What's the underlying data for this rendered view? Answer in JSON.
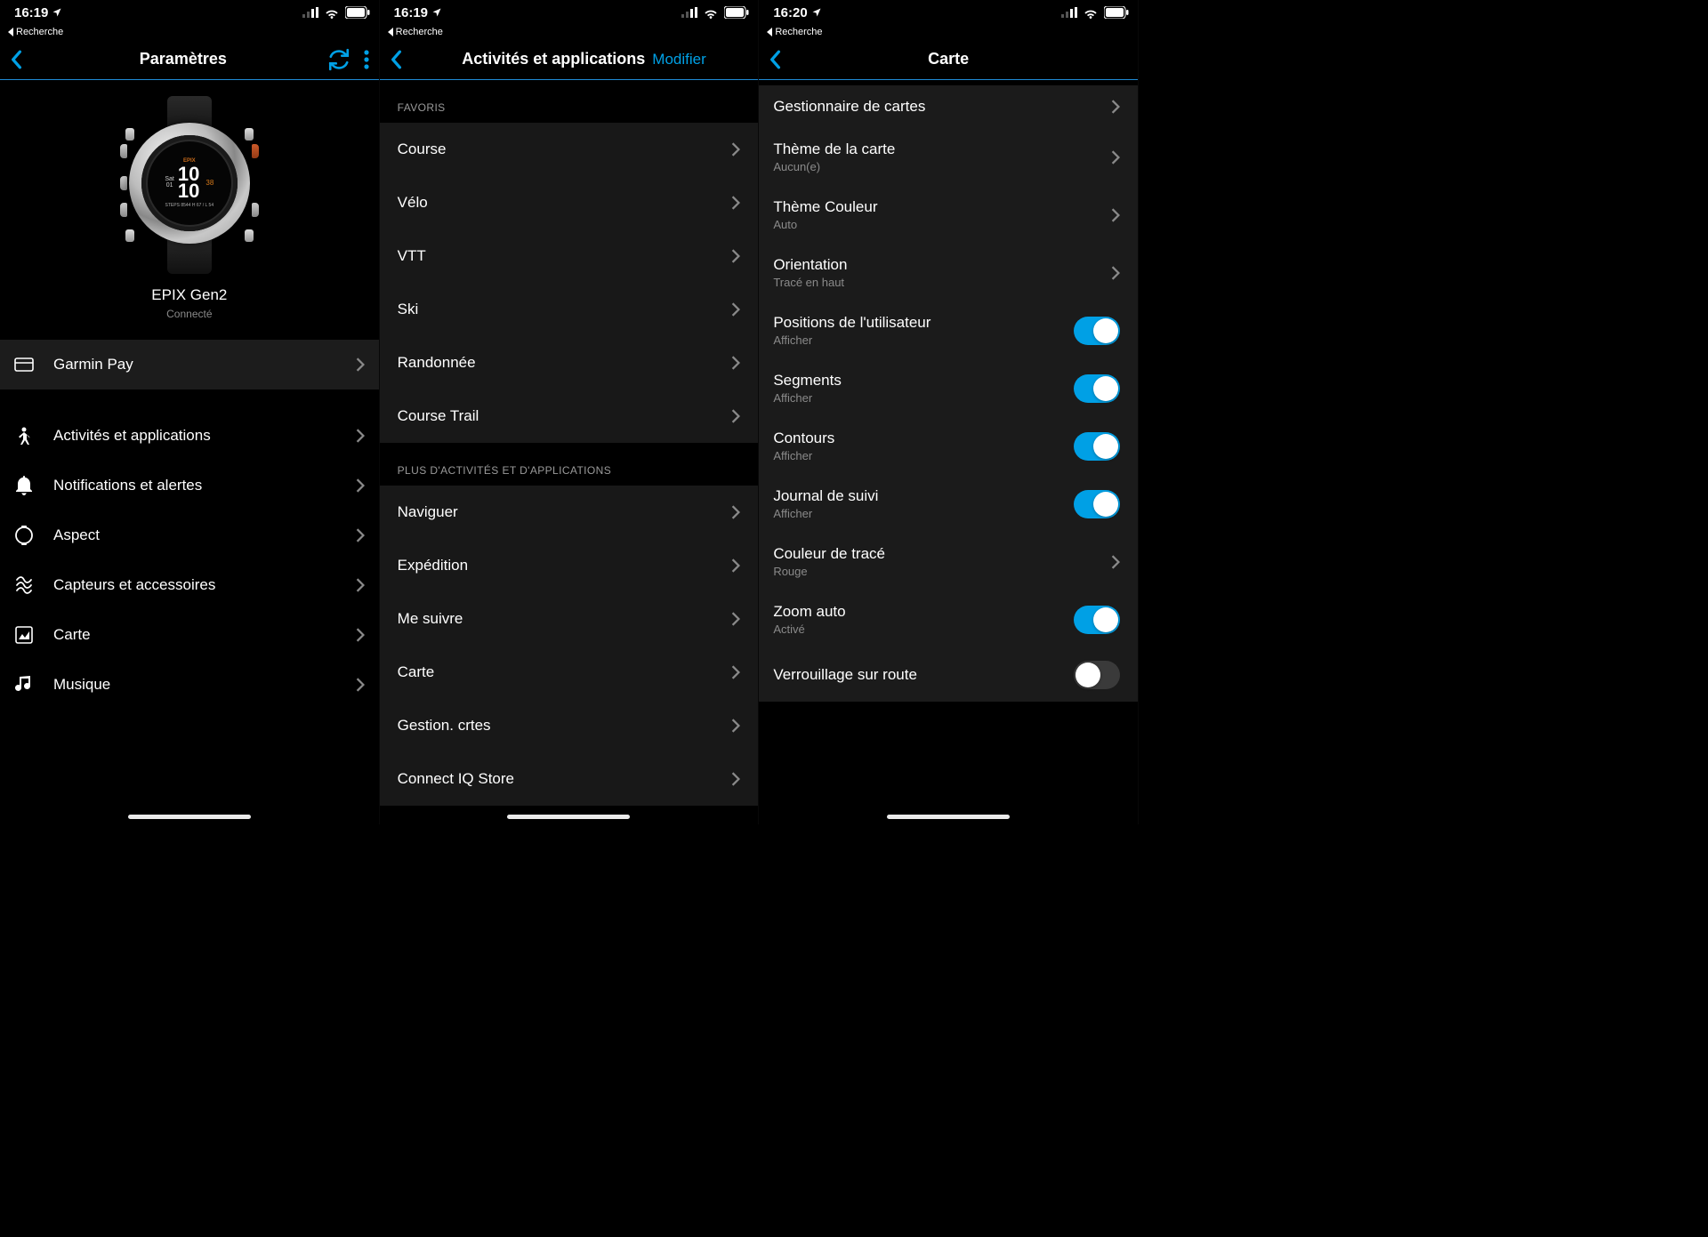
{
  "status": {
    "time1": "16:19",
    "time2": "16:19",
    "time3": "16:20",
    "back_label": "Recherche"
  },
  "pane1": {
    "title": "Paramètres",
    "device_name": "EPIX Gen2",
    "device_status": "Connecté",
    "watch": {
      "brand": "EPIX",
      "day": "Sat",
      "date": "01",
      "hh": "10",
      "mm": "10",
      "alt": "38",
      "small": "STEPS 8544  H 67 / L 54"
    },
    "garmin_pay": "Garmin Pay",
    "items": [
      {
        "label": "Activités et applications"
      },
      {
        "label": "Notifications et alertes"
      },
      {
        "label": "Aspect"
      },
      {
        "label": "Capteurs et accessoires"
      },
      {
        "label": "Carte"
      },
      {
        "label": "Musique"
      }
    ]
  },
  "pane2": {
    "title": "Activités et applications",
    "modifier": "Modifier",
    "sect1": "FAVORIS",
    "favoris": [
      {
        "label": "Course"
      },
      {
        "label": "Vélo"
      },
      {
        "label": "VTT"
      },
      {
        "label": "Ski"
      },
      {
        "label": "Randonnée"
      },
      {
        "label": "Course Trail"
      }
    ],
    "sect2": "PLUS D'ACTIVITÉS ET D'APPLICATIONS",
    "plus": [
      {
        "label": "Naviguer"
      },
      {
        "label": "Expédition"
      },
      {
        "label": "Me suivre"
      },
      {
        "label": "Carte"
      },
      {
        "label": "Gestion. crtes"
      },
      {
        "label": "Connect IQ Store"
      }
    ]
  },
  "pane3": {
    "title": "Carte",
    "rows": [
      {
        "title": "Gestionnaire de cartes",
        "sub": "",
        "type": "chev"
      },
      {
        "title": "Thème de la carte",
        "sub": "Aucun(e)",
        "type": "chev"
      },
      {
        "title": "Thème Couleur",
        "sub": "Auto",
        "type": "chev"
      },
      {
        "title": "Orientation",
        "sub": "Tracé en haut",
        "type": "chev"
      },
      {
        "title": "Positions de l'utilisateur",
        "sub": "Afficher",
        "type": "toggle"
      },
      {
        "title": "Segments",
        "sub": "Afficher",
        "type": "toggle"
      },
      {
        "title": "Contours",
        "sub": "Afficher",
        "type": "toggle"
      },
      {
        "title": "Journal de suivi",
        "sub": "Afficher",
        "type": "toggle"
      },
      {
        "title": "Couleur de tracé",
        "sub": "Rouge",
        "type": "chev"
      },
      {
        "title": "Zoom auto",
        "sub": "Activé",
        "type": "toggle"
      },
      {
        "title": "Verrouillage sur route",
        "sub": "",
        "type": "toggle-off"
      }
    ]
  }
}
